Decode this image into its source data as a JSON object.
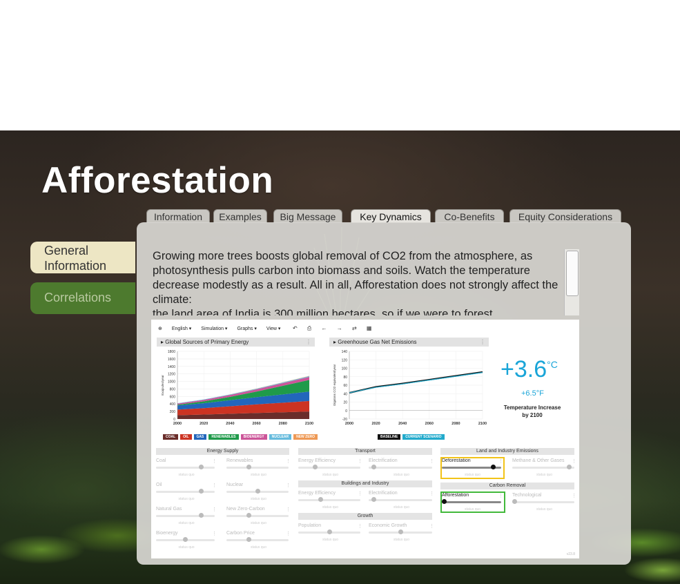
{
  "title": "Afforestation",
  "tabs": [
    "Information",
    "Examples",
    "Big Message",
    "Key Dynamics",
    "Co-Benefits",
    "Equity Considerations"
  ],
  "active_tab": "Key Dynamics",
  "sidebar": {
    "general": "General Information",
    "correlations": "Correlations"
  },
  "text": {
    "p1": "Growing more trees boosts global removal of CO2 from the atmosphere, as photosynthesis pulls carbon into biomass and soils. Watch the temperature decrease modestly as a result. All in all, Afforestation does not strongly affect the climate:",
    "p2": "the land area of India is 300 million hectares, so if we were to forest"
  },
  "sim": {
    "menu": [
      "English ▾",
      "Simulation ▾",
      "Graphs ▾",
      "View ▾"
    ],
    "tool_icons": "↶ ⎙ ← → ⇄ ▦",
    "graph1_title": "Global Sources of Primary Energy",
    "graph2_title": "Greenhouse Gas Net Emissions",
    "temp": {
      "value": "+3.6",
      "unit": "°C",
      "sub": "+6.5°F",
      "label": "Temperature Increase by 2100"
    },
    "legend1": [
      {
        "label": "COAL",
        "color": "#6a2d2a"
      },
      {
        "label": "OIL",
        "color": "#cc3322"
      },
      {
        "label": "GAS",
        "color": "#2266bb"
      },
      {
        "label": "RENEWABLES",
        "color": "#1f9a4a"
      },
      {
        "label": "BIOENERGY",
        "color": "#cc5599"
      },
      {
        "label": "NUCLEAR",
        "color": "#66bbdd"
      },
      {
        "label": "NEW ZERO",
        "color": "#ee9955"
      }
    ],
    "legend2": [
      {
        "label": "BASELINE",
        "color": "#111111"
      },
      {
        "label": "CURRENT SCENARIO",
        "color": "#22aacc"
      }
    ],
    "sections": {
      "energy": "Energy Supply",
      "transport": "Transport",
      "land": "Land and Industry Emissions",
      "buildings": "Buildings and Industry",
      "carbon": "Carbon Removal",
      "growth": "Growth"
    },
    "sliders": {
      "coal": "Coal",
      "renewables": "Renewables",
      "oil": "Oil",
      "nuclear": "Nuclear",
      "natural_gas": "Natural Gas",
      "new_zero": "New Zero-Carbon",
      "bioenergy": "Bioenergy",
      "carbon_price": "Carbon Price",
      "t_eff": "Energy Efficiency",
      "t_elec": "Electrification",
      "b_eff": "Energy Efficiency",
      "b_elec": "Electrification",
      "population": "Population",
      "economic": "Economic Growth",
      "deforestation": "Deforestation",
      "methane": "Methane & Other Gases",
      "afforestation": "Afforestation",
      "technological": "Technological"
    },
    "status_quo": "status quo",
    "levels": {
      "coal": 0.79,
      "renewables": 0.35,
      "oil": 0.79,
      "nuclear": 0.5,
      "natural_gas": 0.79,
      "new_zero": 0.35,
      "bioenergy": 0.5,
      "carbon_price": 0.35,
      "t_eff": 0.25,
      "t_elec": 0.05,
      "b_eff": 0.35,
      "b_elec": 0.05,
      "population": 0.5,
      "economic": 0.5,
      "deforestation": 0.9,
      "methane": 0.95,
      "afforestation": 0.0,
      "technological": 0.0
    },
    "version": "v23.8"
  },
  "chart_data": [
    {
      "type": "area",
      "title": "Global Sources of Primary Energy",
      "ylabel": "Exajoules/year",
      "x": [
        2000,
        2020,
        2040,
        2060,
        2080,
        2100
      ],
      "xlim": [
        2000,
        2100
      ],
      "ylim": [
        0,
        1800
      ],
      "yticks": [
        0,
        200,
        400,
        600,
        800,
        1000,
        1200,
        1400,
        1600,
        1800
      ],
      "series": [
        {
          "name": "COAL",
          "values": [
            100,
            120,
            140,
            160,
            180,
            200
          ]
        },
        {
          "name": "OIL",
          "values": [
            150,
            170,
            200,
            230,
            255,
            280
          ]
        },
        {
          "name": "GAS",
          "values": [
            110,
            130,
            160,
            190,
            220,
            250
          ]
        },
        {
          "name": "RENEWABLES",
          "values": [
            20,
            50,
            90,
            150,
            230,
            310
          ]
        },
        {
          "name": "BIOENERGY",
          "values": [
            30,
            40,
            50,
            60,
            70,
            80
          ]
        },
        {
          "name": "NUCLEAR",
          "values": [
            10,
            12,
            14,
            16,
            18,
            20
          ]
        },
        {
          "name": "NEW ZERO",
          "values": [
            0,
            0,
            2,
            4,
            6,
            8
          ]
        }
      ],
      "grid": true
    },
    {
      "type": "line",
      "title": "Greenhouse Gas Net Emissions",
      "ylabel": "Gigatons CO2 equivalent/year",
      "x": [
        2000,
        2020,
        2040,
        2060,
        2080,
        2100
      ],
      "xlim": [
        2000,
        2100
      ],
      "ylim": [
        -20,
        140
      ],
      "yticks": [
        -20,
        0,
        20,
        40,
        60,
        80,
        100,
        120,
        140
      ],
      "series": [
        {
          "name": "BASELINE",
          "values": [
            42,
            56,
            64,
            73,
            82,
            91
          ]
        },
        {
          "name": "CURRENT SCENARIO",
          "values": [
            42,
            55,
            63,
            72,
            81,
            90
          ]
        }
      ],
      "grid": true
    }
  ]
}
